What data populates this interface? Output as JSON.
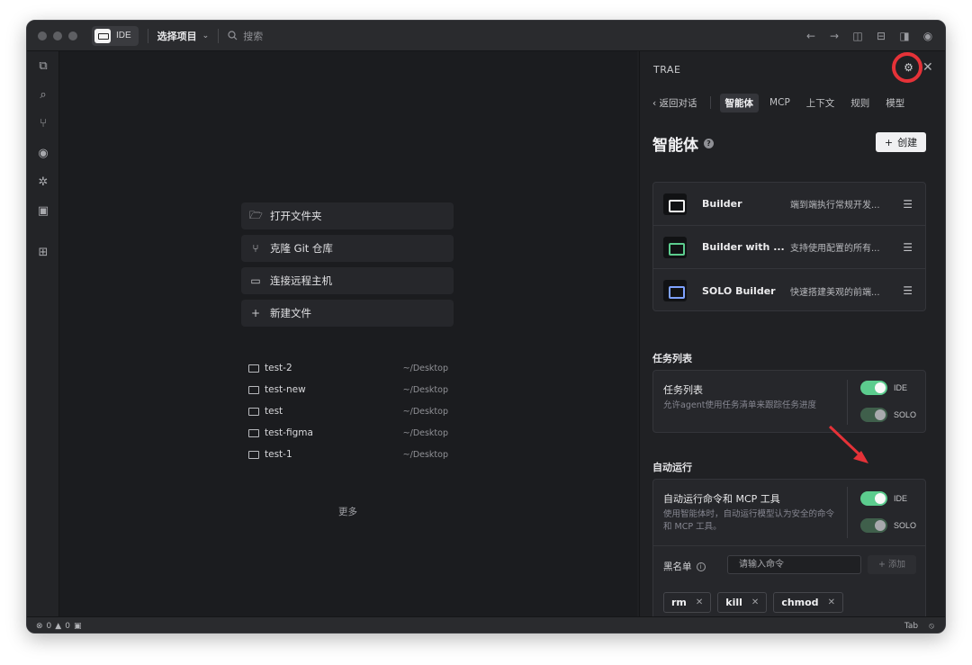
{
  "titlebar": {
    "app_label": "IDE",
    "project_selector": "选择项目",
    "search_placeholder": "搜索"
  },
  "editor": {
    "actions": [
      {
        "icon": "folder-open-icon",
        "label": "打开文件夹"
      },
      {
        "icon": "git-branch-icon",
        "label": "克隆 Git 仓库"
      },
      {
        "icon": "remote-terminal-icon",
        "label": "连接远程主机"
      },
      {
        "icon": "plus-icon",
        "label": "新建文件"
      }
    ],
    "recent": [
      {
        "name": "test-2",
        "path": "~/Desktop"
      },
      {
        "name": "test-new",
        "path": "~/Desktop"
      },
      {
        "name": "test",
        "path": "~/Desktop"
      },
      {
        "name": "test-figma",
        "path": "~/Desktop"
      },
      {
        "name": "test-1",
        "path": "~/Desktop"
      }
    ],
    "more_label": "更多"
  },
  "panel": {
    "title": "TRAE",
    "back_label": "返回对话",
    "tabs": [
      "智能体",
      "MCP",
      "上下文",
      "规则",
      "模型"
    ],
    "active_tab": "智能体",
    "heading": "智能体",
    "create_label": "创建",
    "agents": [
      {
        "name": "Builder",
        "desc": "端到端执行常规开发...",
        "color": "#f2f2f2"
      },
      {
        "name": "Builder with ...",
        "desc": "支持使用配置的所有...",
        "color": "#5ccc8e"
      },
      {
        "name": "SOLO Builder",
        "desc": "快速搭建美观的前端...",
        "color": "#7fa2ff"
      }
    ],
    "tasklist": {
      "section_title": "任务列表",
      "title": "任务列表",
      "desc": "允许agent使用任务清单来跟踪任务进度",
      "toggles": [
        {
          "label": "IDE",
          "state": "on"
        },
        {
          "label": "SOLO",
          "state": "on-disabled"
        }
      ]
    },
    "autorun": {
      "section_title": "自动运行",
      "title": "自动运行命令和 MCP 工具",
      "desc": "使用智能体时，自动运行模型认为安全的命令和 MCP 工具。",
      "toggles": [
        {
          "label": "IDE",
          "state": "on"
        },
        {
          "label": "SOLO",
          "state": "on-disabled"
        }
      ],
      "blacklist_label": "黑名单",
      "blacklist_placeholder": "请输入命令",
      "add_label": "+ 添加",
      "blacklist": [
        "rm",
        "kill",
        "chmod"
      ]
    }
  },
  "statusbar": {
    "errors": "0",
    "warnings": "0",
    "tab_label": "Tab"
  },
  "colors": {
    "accent_green": "#5ccc8e",
    "highlight_red": "#e53238"
  }
}
